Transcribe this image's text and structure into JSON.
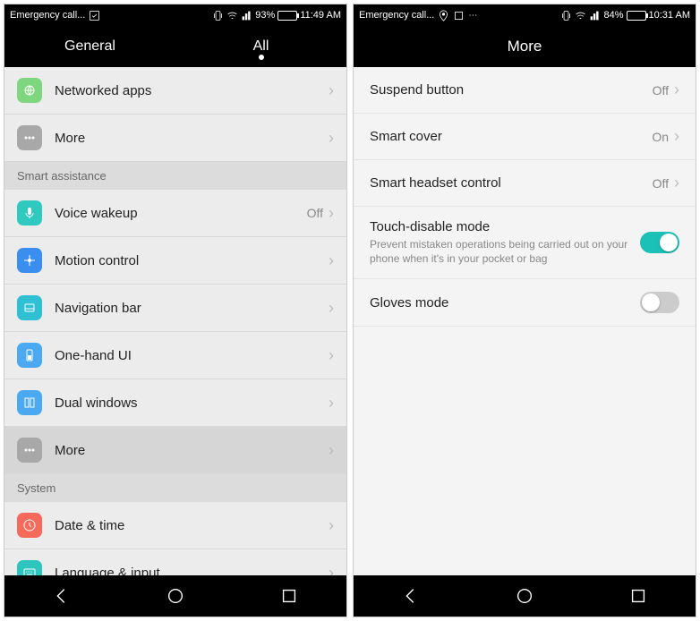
{
  "left": {
    "status": {
      "carrier": "Emergency call...",
      "battery_pct": "93%",
      "time": "11:49 AM",
      "battery_fill": 93
    },
    "tabs": {
      "general": "General",
      "all": "All"
    },
    "rows": {
      "networked_apps": "Networked apps",
      "more1": "More",
      "voice_wakeup": "Voice wakeup",
      "voice_wakeup_val": "Off",
      "motion_control": "Motion control",
      "navigation_bar": "Navigation bar",
      "one_hand_ui": "One-hand UI",
      "dual_windows": "Dual windows",
      "more2": "More",
      "date_time": "Date & time",
      "language_input": "Language & input"
    },
    "sections": {
      "smart_assistance": "Smart assistance",
      "system": "System"
    }
  },
  "right": {
    "status": {
      "carrier": "Emergency call...",
      "battery_pct": "84%",
      "time": "10:31 AM",
      "battery_fill": 84
    },
    "title": "More",
    "rows": {
      "suspend_button": "Suspend button",
      "suspend_button_val": "Off",
      "smart_cover": "Smart cover",
      "smart_cover_val": "On",
      "smart_headset": "Smart headset control",
      "smart_headset_val": "Off",
      "touch_disable": "Touch-disable mode",
      "touch_disable_sub": "Prevent mistaken operations being carried out on your phone when it's in your pocket or bag",
      "gloves_mode": "Gloves mode"
    }
  }
}
